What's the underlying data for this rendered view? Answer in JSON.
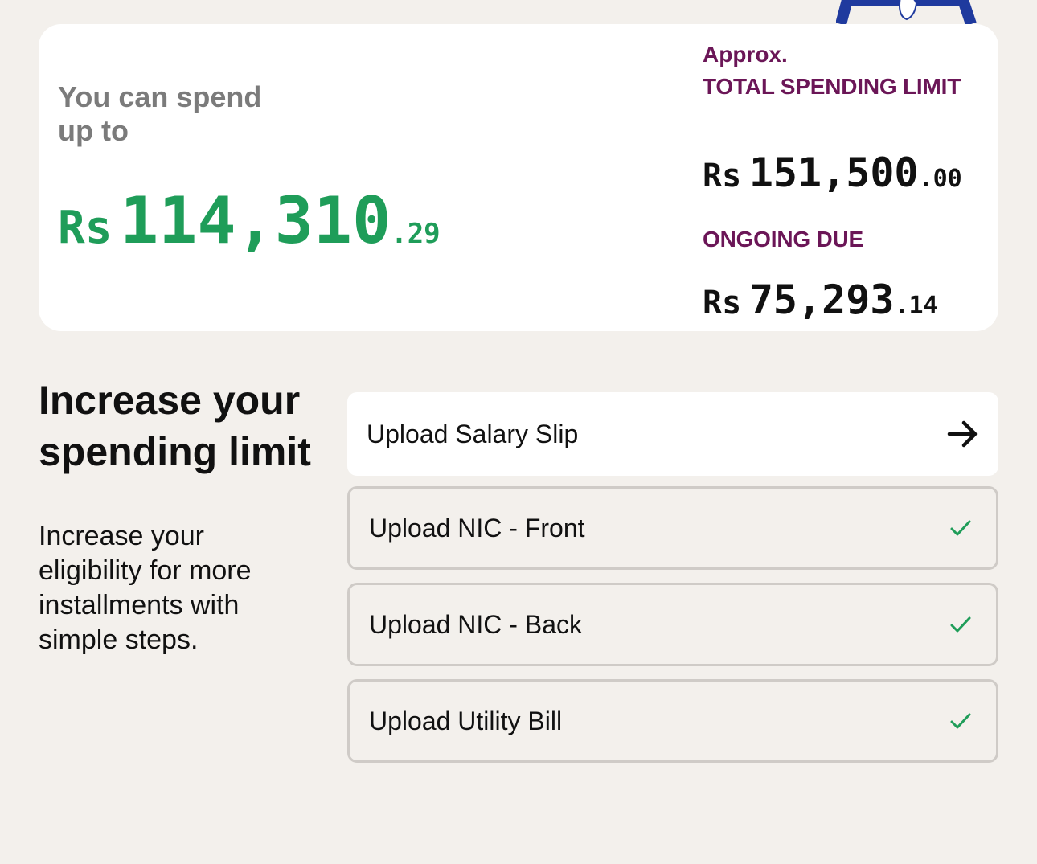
{
  "spend": {
    "label": "You can spend up to",
    "currency": "Rs",
    "amount_int": "114,310",
    "amount_dec": ".29"
  },
  "limit": {
    "approx": "Approx.",
    "label": "TOTAL SPENDING LIMIT",
    "currency": "Rs",
    "amount_int": "151,500",
    "amount_dec": ".00"
  },
  "due": {
    "label": "ONGOING DUE",
    "currency": "Rs",
    "amount_int": "75,293",
    "amount_dec": ".14"
  },
  "increase": {
    "title": "Increase your spending limit",
    "description": "Increase your eligibility for more installments with simple steps."
  },
  "uploads": [
    {
      "label": "Upload Salary Slip",
      "status": "pending",
      "icon": "arrow-right-icon"
    },
    {
      "label": "Upload NIC - Front",
      "status": "done",
      "icon": "checkmark-icon"
    },
    {
      "label": "Upload NIC - Back",
      "status": "done",
      "icon": "checkmark-icon"
    },
    {
      "label": "Upload Utility Bill",
      "status": "done",
      "icon": "checkmark-icon"
    }
  ],
  "colors": {
    "background": "#f3f0ec",
    "spend_green": "#1f9d59",
    "label_purple": "#6b1657",
    "check_green": "#1f9d59",
    "border_gray": "#cfcbc7"
  }
}
